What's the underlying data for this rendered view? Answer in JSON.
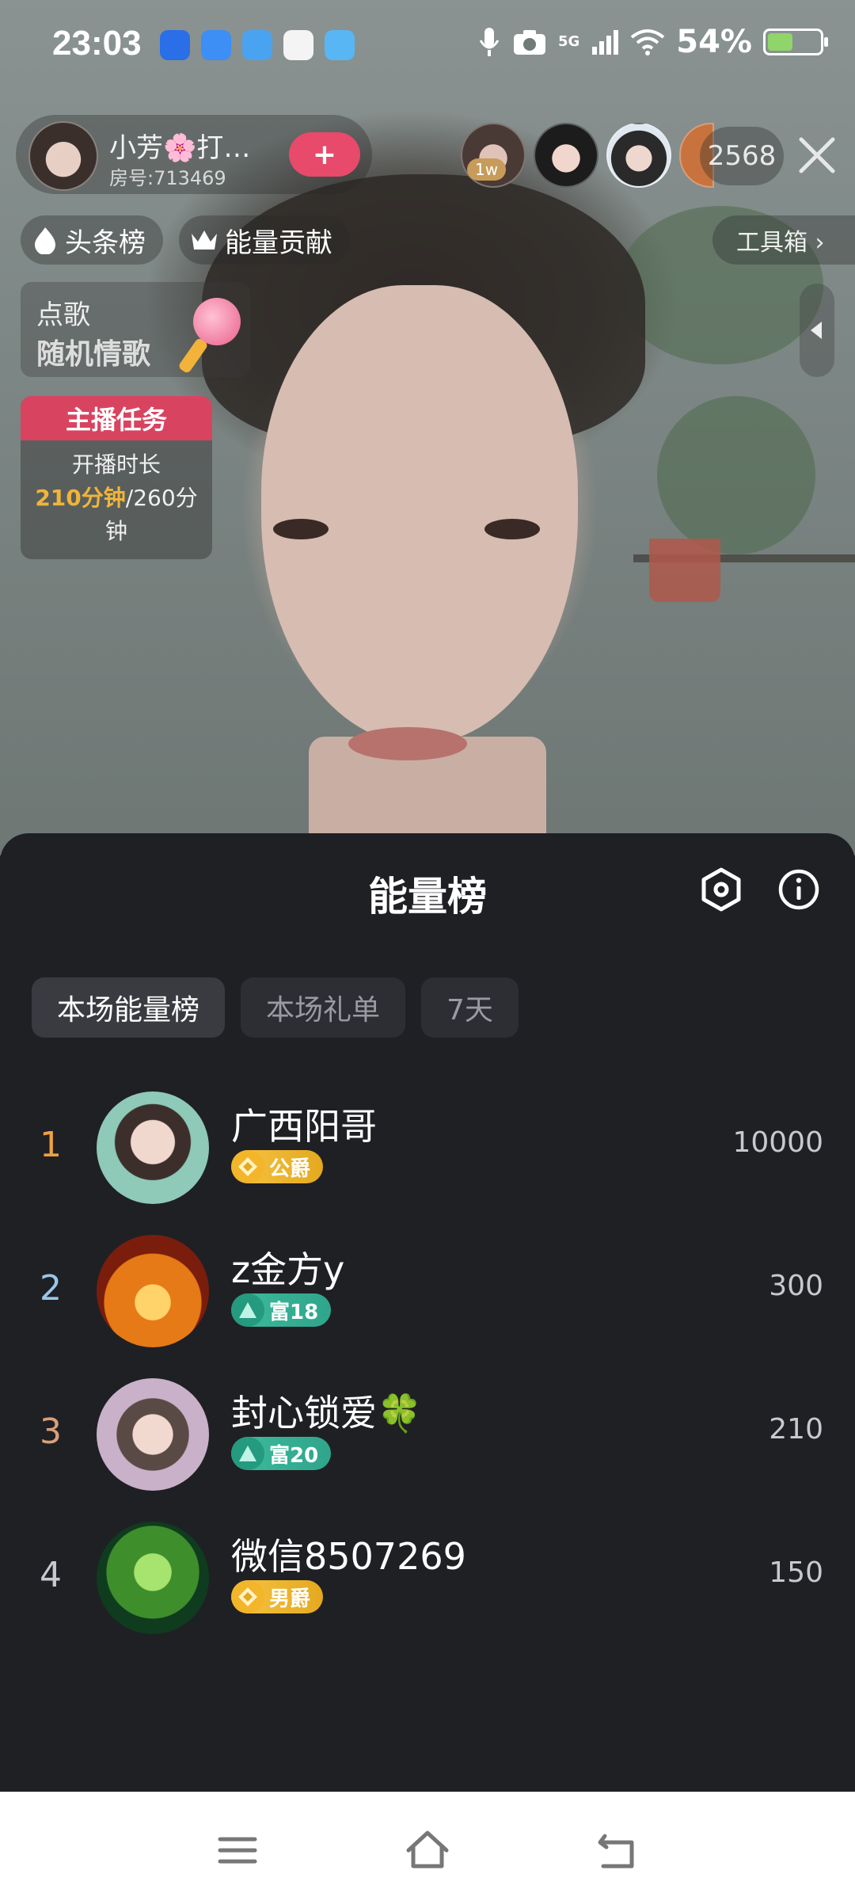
{
  "status_bar": {
    "time": "23:03",
    "network": "5G",
    "battery": "54%",
    "battery_level": 0.54,
    "app_icons": [
      "k-app-icon",
      "paper-plane-icon",
      "phone-app-icon",
      "maps-icon",
      "weather-icon"
    ],
    "icons": [
      "microphone-icon",
      "camera-icon",
      "signal-icon",
      "wifi-icon",
      "battery-icon"
    ]
  },
  "host": {
    "name": "小芳🌸打…",
    "room": "房号:713469",
    "follow_label": "+"
  },
  "viewers": {
    "top_tag": "1w",
    "count": "2568"
  },
  "chips": {
    "headline": "头条榜",
    "energy_contribution": "能量贡献",
    "toolbox": "工具箱 ›"
  },
  "song_request": {
    "title": "点歌",
    "subtitle": "随机情歌"
  },
  "anchor_task": {
    "title": "主播任务",
    "label": "开播时长",
    "progress_done": "210分钟",
    "progress_total": "/260分",
    "progress_unit": "钟"
  },
  "sheet": {
    "title": "能量榜",
    "tabs": [
      {
        "label": "本场能量榜",
        "active": true
      },
      {
        "label": "本场礼单",
        "active": false
      },
      {
        "label": "7天",
        "active": false
      }
    ],
    "rankings": [
      {
        "rank": "1",
        "name": "广西阳哥",
        "badge": "公爵",
        "badge_type": "gold",
        "score": "10000",
        "rank_color": "#f0a040"
      },
      {
        "rank": "2",
        "name": "z金方y",
        "badge": "富18",
        "badge_type": "teal",
        "score": "300",
        "rank_color": "#9ac6e8"
      },
      {
        "rank": "3",
        "name": "封心锁爱🍀",
        "badge": "富20",
        "badge_type": "teal",
        "score": "210",
        "rank_color": "#d9a07a"
      },
      {
        "rank": "4",
        "name": "微信8507269",
        "badge": "男爵",
        "badge_type": "gold",
        "score": "150",
        "rank_color": "#c8c9cf"
      }
    ]
  },
  "colors": {
    "sheet_bg": "#1f2024",
    "accent_pink": "#d84460",
    "gold_badge": "#e4a91f",
    "teal_badge": "#2fa58c"
  }
}
